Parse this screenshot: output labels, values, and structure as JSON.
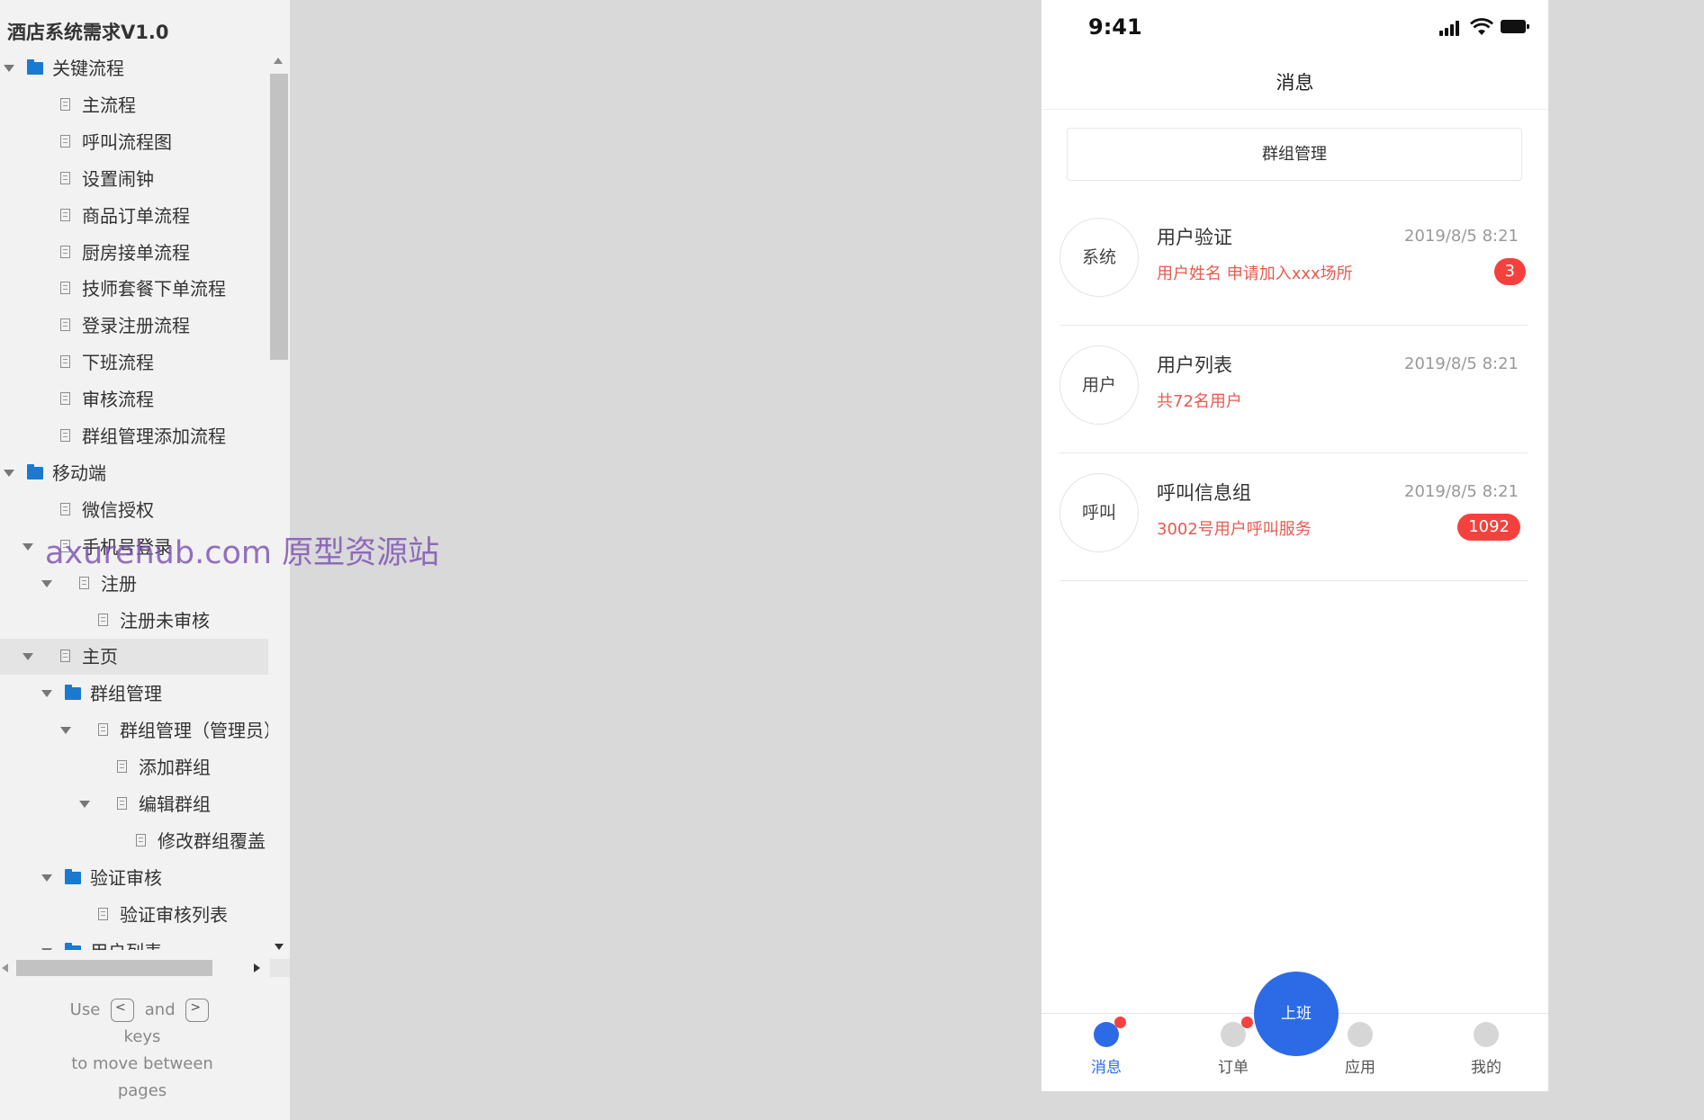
{
  "sidebar": {
    "project_title": "酒店系统需求V1.0",
    "tree": [
      {
        "label": "关键流程",
        "type": "folder",
        "level": 0,
        "expanded": true
      },
      {
        "label": "主流程",
        "type": "page",
        "level": 1
      },
      {
        "label": "呼叫流程图",
        "type": "page",
        "level": 1
      },
      {
        "label": "设置闹钟",
        "type": "page",
        "level": 1
      },
      {
        "label": "商品订单流程",
        "type": "page",
        "level": 1
      },
      {
        "label": "厨房接单流程",
        "type": "page",
        "level": 1
      },
      {
        "label": "技师套餐下单流程",
        "type": "page",
        "level": 1
      },
      {
        "label": "登录注册流程",
        "type": "page",
        "level": 1
      },
      {
        "label": "下班流程",
        "type": "page",
        "level": 1
      },
      {
        "label": "审核流程",
        "type": "page",
        "level": 1
      },
      {
        "label": "群组管理添加流程",
        "type": "page",
        "level": 1
      },
      {
        "label": "移动端",
        "type": "folder",
        "level": 0,
        "expanded": true
      },
      {
        "label": "微信授权",
        "type": "page",
        "level": 1
      },
      {
        "label": "手机号登录",
        "type": "page",
        "level": 1,
        "expanded": true
      },
      {
        "label": "注册",
        "type": "page",
        "level": 2,
        "expanded": true
      },
      {
        "label": "注册未审核",
        "type": "page",
        "level": 3
      },
      {
        "label": "主页",
        "type": "page",
        "level": 1,
        "expanded": true,
        "selected": true
      },
      {
        "label": "群组管理",
        "type": "folder",
        "level": 2,
        "expanded": true
      },
      {
        "label": "群组管理（管理员）",
        "type": "page",
        "level": 3,
        "expanded": true
      },
      {
        "label": "添加群组",
        "type": "page",
        "level": 4
      },
      {
        "label": "编辑群组",
        "type": "page",
        "level": 4,
        "expanded": true
      },
      {
        "label": "修改群组覆盖",
        "type": "page",
        "level": 5
      },
      {
        "label": "验证审核",
        "type": "folder",
        "level": 2,
        "expanded": true
      },
      {
        "label": "验证审核列表",
        "type": "page",
        "level": 3
      },
      {
        "label": "用户列表",
        "type": "folder",
        "level": 2,
        "expanded": true
      }
    ],
    "help": {
      "use": "Use",
      "key_prev": "<",
      "and": "and",
      "key_next": ">",
      "keys": "keys",
      "line2": "to move between",
      "line3": "pages"
    }
  },
  "watermark": "axurehub.com 原型资源站",
  "phone": {
    "status_time": "9:41",
    "nav_title": "消息",
    "group_button_label": "群组管理",
    "messages": [
      {
        "avatar": "系统",
        "title": "用户验证",
        "time": "2019/8/5 8:21",
        "subtitle": "用户姓名 申请加入xxx场所",
        "badge": "3"
      },
      {
        "avatar": "用户",
        "title": "用户列表",
        "time": "2019/8/5 8:21",
        "subtitle": "共72名用户",
        "badge": ""
      },
      {
        "avatar": "呼叫",
        "title": "呼叫信息组",
        "time": "2019/8/5 8:21",
        "subtitle": "3002号用户呼叫服务",
        "badge": "1092"
      }
    ],
    "clock_in_label": "上班",
    "tabs": [
      {
        "label": "消息",
        "active": true,
        "dot": true
      },
      {
        "label": "订单",
        "active": false,
        "dot": true
      },
      {
        "label": "应用",
        "active": false,
        "dot": false
      },
      {
        "label": "我的",
        "active": false,
        "dot": false
      }
    ],
    "colors": {
      "accent": "#2d6ae6",
      "badge": "#f5413e",
      "subtitle": "#e85a4f"
    }
  }
}
